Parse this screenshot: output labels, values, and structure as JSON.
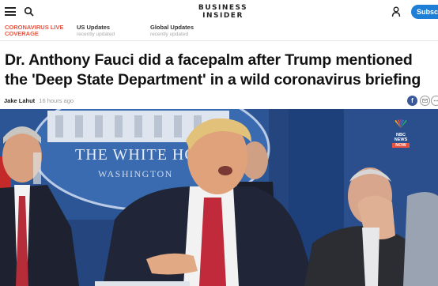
{
  "header": {
    "logo_line1": "BUSINESS",
    "logo_line2": "INSIDER",
    "subscribe_label": "Subscr",
    "icons": [
      "menu-icon",
      "search-icon",
      "user-icon"
    ]
  },
  "updates": {
    "live_line1": "CORONAVIRUS LIVE",
    "live_line2": "COVERAGE",
    "items": [
      {
        "title": "US Updates",
        "subtitle": "recently updated"
      },
      {
        "title": "Global Updates",
        "subtitle": "recently updated"
      }
    ]
  },
  "article": {
    "headline": "Dr. Anthony Fauci did a facepalm after Trump mentioned the 'Deep State Department' in a wild coronavirus briefing",
    "author": "Jake Lahut",
    "time": "16 hours ago",
    "share_icons": [
      "facebook-icon",
      "mail-icon",
      "more-icon"
    ]
  },
  "hero": {
    "seal_line1": "THE WHITE HO",
    "seal_line2": "WASHINGTON",
    "network_line1": "NBC",
    "network_line2": "NEWS",
    "network_badge": "NOW"
  },
  "colors": {
    "accent_blue": "#1f7fd6",
    "live_red": "#e8523f",
    "backdrop_blue": "#2a4a82"
  }
}
